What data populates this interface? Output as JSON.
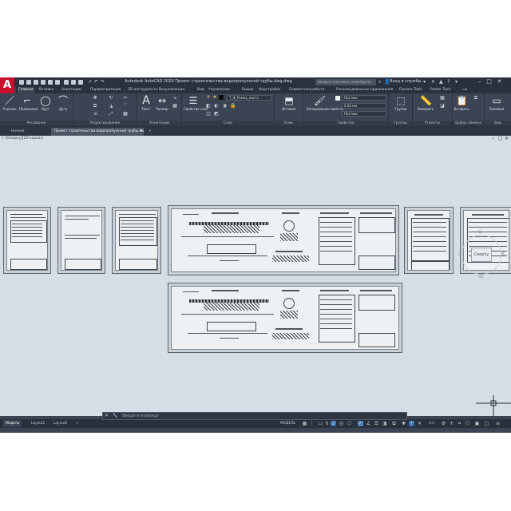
{
  "app": {
    "title": "Autodesk AutoCAD 2020   Проект строительства водопропускной трубы.dwg.dwg",
    "logo_letter": "A",
    "search_placeholder": "Введите ключевое слово/фразу",
    "user": "Вход в службы",
    "accent": "#c8102e",
    "window_controls": [
      "–",
      "□",
      "✕"
    ]
  },
  "ribbon_tabs": [
    "Главная",
    "Вставка",
    "Аннотации",
    "Параметризация",
    "3D инструменты",
    "Визуализация",
    "Вид",
    "Управление",
    "Вывод",
    "Надстройки",
    "Совместная работа",
    "Рекомендованные приложения",
    "Express Tools",
    "Raster Tools"
  ],
  "ribbon": {
    "draw_tools": [
      "Отрезок",
      "Полилиния",
      "Круг",
      "Дуга"
    ],
    "text_tools": [
      "Текст",
      "Размер"
    ],
    "layer_props_label": "Свойства слоя",
    "layer_current": "Т_Ф_Рамка_листа",
    "insert_label": "Вставка",
    "match_label": "Копирование свойств",
    "prop_value_1": "ПоСлою",
    "prop_value_2": "0.00 мм",
    "prop_value_3": "ПоСлою",
    "group_label": "Группа",
    "measure_label": "Измерить",
    "paste_label": "Вставить",
    "base_label": "Базовый",
    "panel_labels": [
      "Рисование",
      "Редактирование",
      "Аннотации",
      "Слои",
      "Блок",
      "Свойства",
      "Группы",
      "Утилиты",
      "Буфер обмена",
      "Вид"
    ]
  },
  "file_tabs": [
    "Начало",
    "Проект строительства водопропускной трубы.dwg",
    "+"
  ],
  "viewport": {
    "label": "[–][Сверху][2D-каркас]",
    "cube_label": "Сверху",
    "compass": [
      "С",
      "З",
      "В",
      "Ю"
    ]
  },
  "command_line": {
    "placeholder": "Введите команду",
    "close_icon": "✕",
    "wrench_icon": "🔧"
  },
  "status_bar": {
    "tabs": [
      "Модель",
      "Layout1",
      "Layout2",
      "+"
    ],
    "model_label": "МОДЕЛЬ",
    "scale": "1:1"
  }
}
